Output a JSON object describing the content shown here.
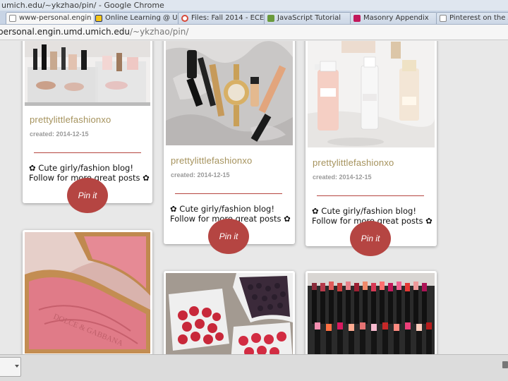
{
  "window": {
    "title": "umich.edu/~ykzhao/pin/ - Google Chrome"
  },
  "tabs": [
    {
      "label": "www-personal.engin",
      "active": true,
      "icon": "page-icon"
    },
    {
      "label": "Online Learning @ U",
      "active": false,
      "icon": "block-m-icon"
    },
    {
      "label": "Files: Fall 2014 - ECE",
      "active": false,
      "icon": "canvas-icon"
    },
    {
      "label": "JavaScript Tutorial",
      "active": false,
      "icon": "w3schools-icon"
    },
    {
      "label": "Masonry Appendix",
      "active": false,
      "icon": "masonry-icon"
    },
    {
      "label": "Pinterest on the App",
      "active": false,
      "icon": "page-icon"
    }
  ],
  "address": {
    "host": "personal.engin.umd.umich.edu",
    "path": "/~ykzhao/pin/"
  },
  "pins": [
    {
      "title": "prettylittlefashionxo",
      "date": "created: 2014-12-15",
      "desc_line1": "✿ Cute girly/fashion blog!",
      "desc_line2": "Follow for more great posts ✿...",
      "button": "Pin it",
      "image": "makeup-organizer-image"
    },
    {
      "title": "prettylittlefashionxo",
      "date": "created: 2014-12-15",
      "desc_line1": "✿ Cute girly/fashion blog!",
      "desc_line2": "Follow for more great posts ✿...",
      "button": "Pin it",
      "image": "cosmetics-on-fur-image"
    },
    {
      "title": "prettylittlefashionxo",
      "date": "created: 2014-12-15",
      "desc_line1": "✿ Cute girly/fashion blog!",
      "desc_line2": "Follow for more great posts ✿...",
      "button": "Pin it",
      "image": "chanel-bottles-image"
    },
    {
      "image": "dolce-gabbana-blush-image"
    },
    {
      "image": "berries-baskets-image"
    },
    {
      "image": "lipstick-display-image"
    }
  ],
  "colors": {
    "title": "#a5925c",
    "accent": "#b54542",
    "rule": "#b64640"
  }
}
